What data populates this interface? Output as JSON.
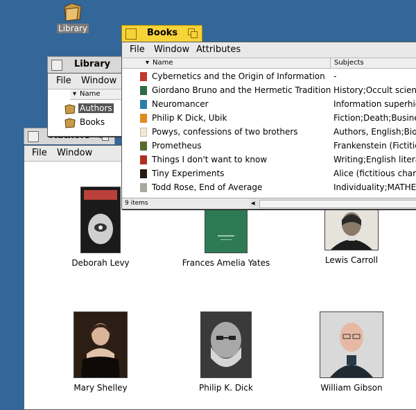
{
  "desktop": {
    "icon_label": "Library"
  },
  "library": {
    "title": "Library",
    "menu": [
      "File",
      "Window"
    ],
    "column": "Name",
    "items": [
      {
        "label": "Authors",
        "selected": true
      },
      {
        "label": "Books",
        "selected": false
      }
    ]
  },
  "authors": {
    "title": "Authors",
    "menu": [
      "File",
      "Window"
    ],
    "people": [
      {
        "name": "Deborah Levy"
      },
      {
        "name": "Frances Amelia Yates"
      },
      {
        "name": "Lewis Carroll"
      },
      {
        "name": "Mary Shelley"
      },
      {
        "name": "Philip K. Dick"
      },
      {
        "name": "William Gibson"
      }
    ]
  },
  "books": {
    "title": "Books",
    "menu": [
      "File",
      "Window",
      "Attributes"
    ],
    "columns": [
      "Name",
      "Subjects"
    ],
    "rows": [
      {
        "name": "Cybernetics and the Origin of Information",
        "subjects": "-",
        "color": "#c0392b"
      },
      {
        "name": "Giordano Bruno and the Hermetic Tradition",
        "subjects": "History;Occult scienc...",
        "color": "#2e6b45"
      },
      {
        "name": "Neuromancer",
        "subjects": "Information superhig...",
        "color": "#2a7fa8"
      },
      {
        "name": "Philip K Dick, Ubik",
        "subjects": "Fiction;Death;Busines...",
        "color": "#e08a1e"
      },
      {
        "name": "Powys, confessions of two brothers",
        "subjects": "Authors, English;Biogr...",
        "color": "#f2ead0"
      },
      {
        "name": "Prometheus",
        "subjects": "Frankenstein (Fictitiou...",
        "color": "#556b2f"
      },
      {
        "name": "Things I don't want to know",
        "subjects": "Writing;English literat...",
        "color": "#b0301f"
      },
      {
        "name": "Tiny Experiments",
        "subjects": "Alice (fictitious charac...",
        "color": "#2b1a12"
      },
      {
        "name": "Todd Rose, End of Average",
        "subjects": "Individuality;MATHE...",
        "color": "#a9a9a0"
      }
    ],
    "status": "9 items"
  }
}
